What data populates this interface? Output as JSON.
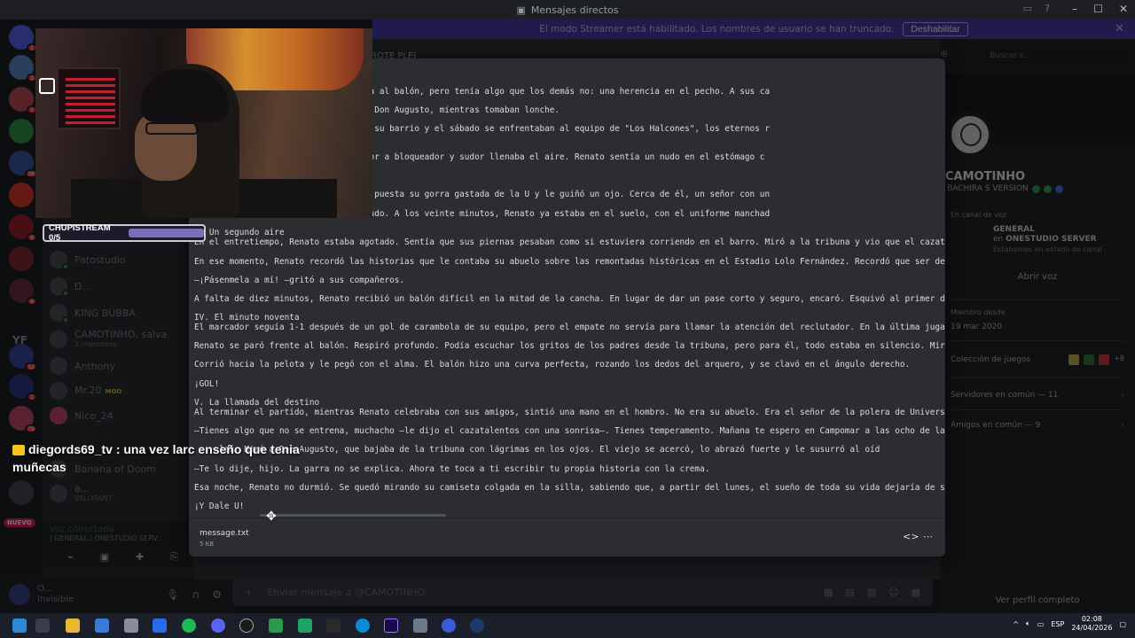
{
  "window": {
    "title": "Mensajes directos"
  },
  "banner": {
    "message": "El modo Streamer está habilitado. Los nombres de usuario se han truncado.",
    "disable_label": "Deshabilitar"
  },
  "server_rail": {
    "other_label": "YF",
    "nuevo_label": "NUEVO"
  },
  "dm_list": [
    {
      "name": "Patostudio",
      "sub": ""
    },
    {
      "name": "D...",
      "sub": ""
    },
    {
      "name": "KING BUBBA",
      "sub": ""
    },
    {
      "name": "CAMOTINHO, salva",
      "sub": "3 miembros"
    },
    {
      "name": "Anthony",
      "sub": ""
    },
    {
      "name": "Mr.20",
      "sub": "",
      "tag": "MOO"
    },
    {
      "name": "Nico_24",
      "sub": ""
    },
    {
      "name": "Banana of Doom",
      "sub": ""
    },
    {
      "name": "a...",
      "sub": "VALORANT"
    }
  ],
  "voice_panel": {
    "title": "Voz conectada",
    "subtitle": "| GENERAL / ONESTUDIO SERV..."
  },
  "user_panel": {
    "name": "O...",
    "status": "Invisible"
  },
  "chat_header": {
    "title": "ROTE PLEI"
  },
  "composer": {
    "placeholder": "Enviar mensaje a @CAMOTINHO"
  },
  "profile": {
    "search_placeholder": "Buscar s...",
    "name": "CAMOTINHO",
    "tag": "BACHIRA S VERSION",
    "voice_section": "En canal de voz",
    "voice_channel": "GENERAL",
    "voice_server_prefix": "en",
    "voice_server": "ONESTUDIO SERVER",
    "voice_note": "Estábamos en estado de canal",
    "open_voice": "Abrir voz",
    "member_since_label": "Miembro desde",
    "member_since": "19 mar 2020",
    "games_label": "Colección de juegos",
    "games_more": "+8",
    "servers_common": "Servidores en común — 11",
    "friends_common": "Amigos en común — 9",
    "view_full": "Ver perfil completo"
  },
  "file_viewer": {
    "filename": "message.txt",
    "filesize": "5 KB",
    "lines": [
      "uipo, tampoco el que mejor le pegaba al balón, pero tenía algo que los demás no: una herencia en el pecho. A sus ca",
      "siente —le decía siempre su abuelo, Don Augusto, mientras tomaban lonche.",
      "nato jugaba en la liga distrital de su barrio y el sábado se enfrentaban al equipo de \"Los Halcones\", los eternos r",
      "",
      "quemaba el pasto sintético, y el olor a bloqueador y sudor llenaba el aire. Renato sentía un nudo en el estómago c",
      "",
      "sto en la tribuna. El viejo llevaba puesta su gorra gastada de la U y le guiñó un ojo. Cerca de él, un señor con un",
      " Halcones eran gigantes y jugaban rudo. A los veinte minutos, Renato ya estaba en el suelo, con el uniforme manchad",
      "I. Un segundo aire",
      "En el entretiempo, Renato estaba agotado. Sentía que sus piernas pesaban como si estuviera corriendo en el barro. Miró a la tribuna y vio que el cazata",
      "En ese momento, Renato recordó las historias que le contaba su abuelo sobre las remontadas históricas en el Estadio Lolo Fernández. Recordó que ser de",
      "—¡Pásenmela a mí! —gritó a sus compañeros.",
      "A falta de diez minutos, Renato recibió un balón difícil en la mitad de la cancha. En lugar de dar un pase corto y seguro, encaró. Esquivó al primer de",
      "IV. El minuto noventa",
      "El marcador seguía 1-1 después de un gol de carambola de su equipo, pero el empate no servía para llamar la atención del reclutador. En la última juga",
      "Renato se paró frente al balón. Respiró profundo. Podía escuchar los gritos de los padres desde la tribuna, pero para él, todo estaba en silencio. Mir",
      "Corrió hacia la pelota y le pegó con el alma. El balón hizo una curva perfecta, rozando los dedos del arquero, y se clavó en el ángulo derecho.",
      "¡GOL!",
      "V. La llamada del destino",
      "Al terminar el partido, mientras Renato celebraba con sus amigos, sintió una mano en el hombro. No era su abuelo. Era el señor de la polera de Univers",
      "—Tienes algo que no se entrena, muchacho —le dijo el cazatalentos con una sonrisa—. Tienes temperamento. Mañana te espero en Campomar a las ocho de la",
      "     lar. Miró a Don Augusto, que bajaba de la tribuna con lágrimas en los ojos. El viejo se acercó, lo abrazó fuerte y le susurró al oíd",
      "—Te lo dije, hijo. La garra no se explica. Ahora te toca a ti escribir tu propia historia con la crema.",
      "Esa noche, Renato no durmió. Se quedó mirando su camiseta colgada en la silla, sabiendo que, a partir del lunes, el sueño de toda su vida dejaría de se",
      "¡Y Dale U!"
    ]
  },
  "stream_overlay": {
    "sub_goal": "CHUPISTREAM 0/5",
    "chat_user": "diegords69_tv",
    "chat_message": ": una vez larc enseño que tenia muñecas"
  },
  "taskbar": {
    "lang": "ESP",
    "time": "02:08",
    "date": "24/04/2026"
  },
  "colors": {
    "banner": "#4a3aa8",
    "online": "#23a55a",
    "badge": "#f23f42",
    "blurple": "#5865f2"
  }
}
